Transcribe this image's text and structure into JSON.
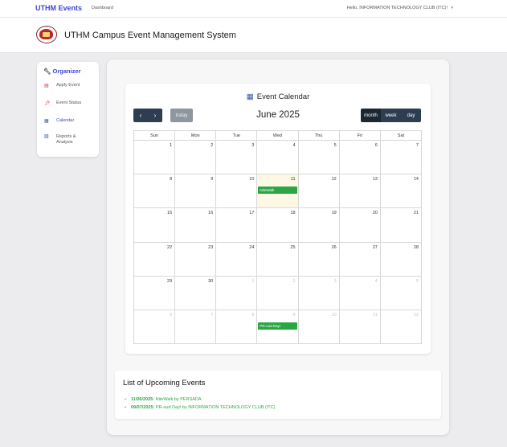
{
  "topnav": {
    "brand": "UTHM Events",
    "dashboard": "Dashboard",
    "user_greeting": "Hello, INFORMATION TECHNOLOGY CLUB (ITC)!"
  },
  "header": {
    "title": "UTHM Campus Event Management System"
  },
  "sidebar": {
    "heading": "Organizer",
    "items": [
      {
        "label": "Apply Event",
        "icon": "document-icon"
      },
      {
        "label": "Event Status",
        "icon": "pin-icon"
      },
      {
        "label": "Calendar",
        "icon": "calendar-icon"
      },
      {
        "label": "Reports & Analysis",
        "icon": "chart-icon"
      }
    ]
  },
  "calendar": {
    "title": "Event Calendar",
    "today_label": "today",
    "month_label": "June 2025",
    "views": [
      "month",
      "week",
      "day"
    ],
    "weekdays": [
      "Sun",
      "Mon",
      "Tue",
      "Wed",
      "Thu",
      "Fri",
      "Sat"
    ],
    "weeks": [
      [
        {
          "n": "1"
        },
        {
          "n": "2"
        },
        {
          "n": "3"
        },
        {
          "n": "4"
        },
        {
          "n": "5"
        },
        {
          "n": "6"
        },
        {
          "n": "7"
        }
      ],
      [
        {
          "n": "8"
        },
        {
          "n": "9"
        },
        {
          "n": "10"
        },
        {
          "n": "11",
          "today": true,
          "event": "NiteWalk"
        },
        {
          "n": "12"
        },
        {
          "n": "13"
        },
        {
          "n": "14"
        }
      ],
      [
        {
          "n": "15"
        },
        {
          "n": "16"
        },
        {
          "n": "17"
        },
        {
          "n": "18"
        },
        {
          "n": "19"
        },
        {
          "n": "20"
        },
        {
          "n": "21"
        }
      ],
      [
        {
          "n": "22"
        },
        {
          "n": "23"
        },
        {
          "n": "24"
        },
        {
          "n": "25"
        },
        {
          "n": "26"
        },
        {
          "n": "27"
        },
        {
          "n": "28"
        }
      ],
      [
        {
          "n": "29"
        },
        {
          "n": "30"
        },
        {
          "n": "1",
          "other": true
        },
        {
          "n": "2",
          "other": true
        },
        {
          "n": "3",
          "other": true
        },
        {
          "n": "4",
          "other": true
        },
        {
          "n": "5",
          "other": true
        }
      ],
      [
        {
          "n": "6",
          "other": true
        },
        {
          "n": "7",
          "other": true
        },
        {
          "n": "8",
          "other": true
        },
        {
          "n": "9",
          "other": true,
          "event": "PR-oud Day!"
        },
        {
          "n": "10",
          "other": true
        },
        {
          "n": "11",
          "other": true
        },
        {
          "n": "12",
          "other": true
        }
      ]
    ]
  },
  "upcoming": {
    "title": "List of Upcoming Events",
    "events": [
      {
        "date": "11/06/2025:",
        "text": " NiteWalk by PERSADA"
      },
      {
        "date": "09/07/2025:",
        "text": " PR-oud Day! by INFORMATION TECHNOLOGY CLUB (ITC)"
      }
    ]
  },
  "colors": {
    "brand": "#3b45d6",
    "event": "#2aa743",
    "button": "#2d3e50",
    "today_bg": "#fcf8e3"
  }
}
